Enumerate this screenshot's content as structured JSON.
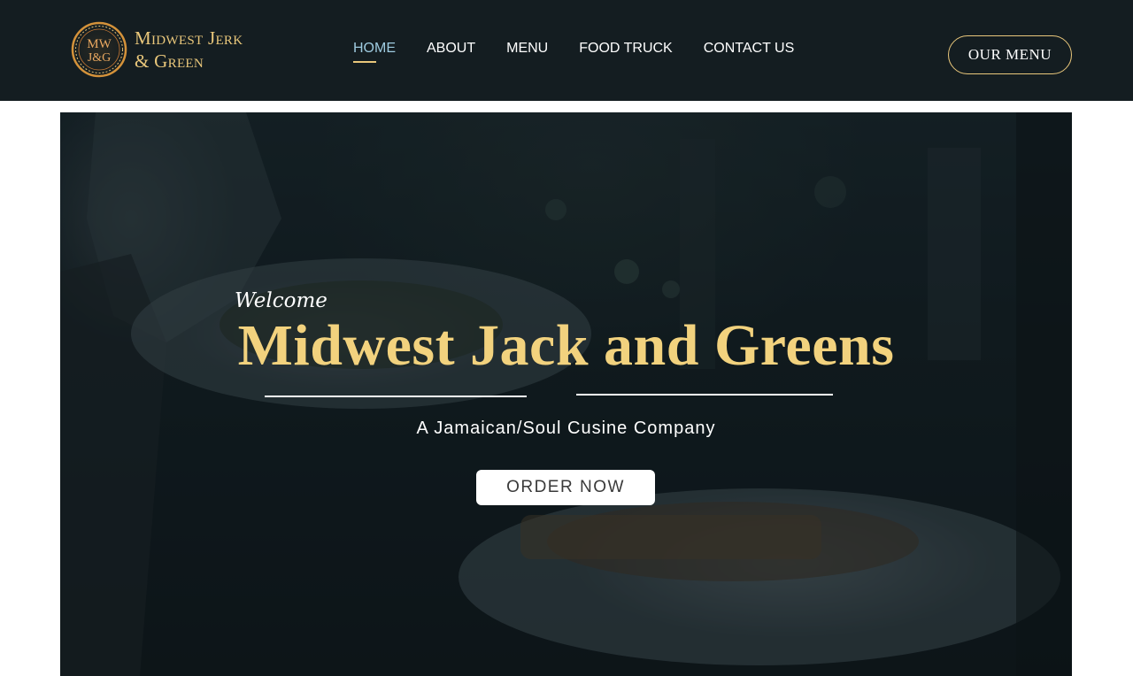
{
  "header": {
    "logo": {
      "monogram": "MW J&G",
      "line1": "Midwest Jerk",
      "line2": "& Green"
    },
    "nav": [
      {
        "label": "HOME",
        "active": true
      },
      {
        "label": "ABOUT",
        "active": false
      },
      {
        "label": "MENU",
        "active": false
      },
      {
        "label": "FOOD TRUCK",
        "active": false
      },
      {
        "label": "CONTACT US",
        "active": false
      }
    ],
    "cta_label": "OUR MENU"
  },
  "hero": {
    "welcome": "Welcome",
    "title": "Midwest Jack and Greens",
    "tagline": "A Jamaican/Soul Cusine Company",
    "order_label": "ORDER NOW",
    "background_image": "waiter-carrying-plates-photo"
  },
  "colors": {
    "header_bg": "#141d21",
    "gold": "#e9c77b",
    "title_gold": "#f2d27e",
    "active_nav": "#9ecbe0",
    "white": "#ffffff"
  }
}
